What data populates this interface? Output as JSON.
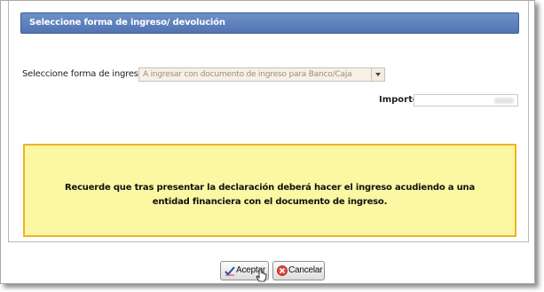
{
  "panel": {
    "title": "Seleccione forma de ingreso/ devolución"
  },
  "forma_ingreso": {
    "label": "Seleccione forma de ingreso:",
    "selected": "A ingresar con documento de ingreso para Banco/Caja"
  },
  "importe": {
    "label": "Importe"
  },
  "notice": {
    "text": "Recuerde que tras presentar la declaración deberá hacer el ingreso acudiendo a una entidad financiera con el documento de ingreso."
  },
  "buttons": {
    "aceptar": "Aceptar",
    "cancelar": "Cancelar"
  },
  "colors": {
    "header_blue": "#5a7dbd",
    "notice_bg": "#fbf7a2",
    "notice_border": "#f0b323"
  },
  "icons": {
    "aceptar": "checkmark-icon",
    "cancelar": "cancel-icon"
  }
}
